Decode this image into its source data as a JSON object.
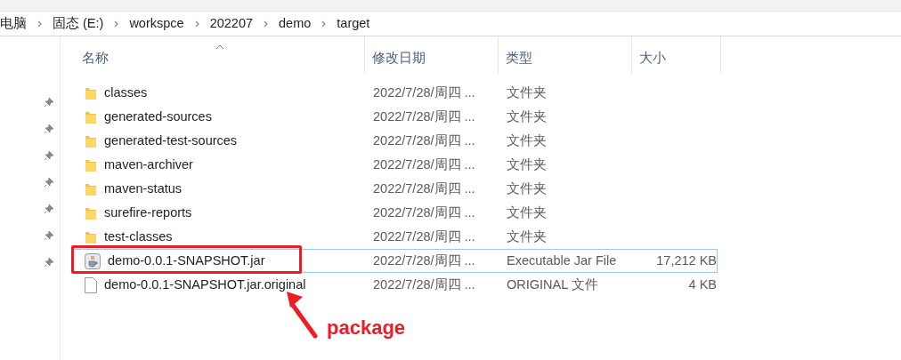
{
  "breadcrumb": [
    "电脑",
    "固态 (E:)",
    "workspce",
    "202207",
    "demo",
    "target"
  ],
  "columns": [
    "名称",
    "修改日期",
    "类型",
    "大小"
  ],
  "rows": [
    {
      "kind": "folder",
      "name": "classes",
      "date": "2022/7/28/周四 ...",
      "type": "文件夹",
      "selected": false
    },
    {
      "kind": "folder",
      "name": "generated-sources",
      "date": "2022/7/28/周四 ...",
      "type": "文件夹",
      "selected": false
    },
    {
      "kind": "folder",
      "name": "generated-test-sources",
      "date": "2022/7/28/周四 ...",
      "type": "文件夹",
      "selected": false
    },
    {
      "kind": "folder",
      "name": "maven-archiver",
      "date": "2022/7/28/周四 ...",
      "type": "文件夹",
      "selected": false
    },
    {
      "kind": "folder",
      "name": "maven-status",
      "date": "2022/7/28/周四 ...",
      "type": "文件夹",
      "selected": false
    },
    {
      "kind": "folder",
      "name": "surefire-reports",
      "date": "2022/7/28/周四 ...",
      "type": "文件夹",
      "selected": false
    },
    {
      "kind": "folder",
      "name": "test-classes",
      "date": "2022/7/28/周四 ...",
      "type": "文件夹",
      "selected": false
    },
    {
      "kind": "jar",
      "name": "demo-0.0.1-SNAPSHOT.jar",
      "date": "2022/7/28/周四 ...",
      "type": "Executable Jar File",
      "size": "17,212 KB",
      "selected": true
    },
    {
      "kind": "file",
      "name": "demo-0.0.1-SNAPSHOT.jar.original",
      "date": "2022/7/28/周四 ...",
      "type": "ORIGINAL 文件",
      "size": "4 KB",
      "selected": false
    }
  ],
  "annotation": {
    "label": "package"
  }
}
